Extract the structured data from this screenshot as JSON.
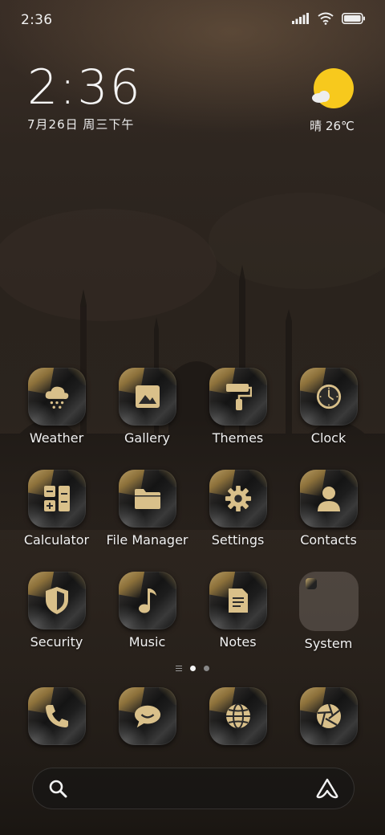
{
  "status_bar": {
    "time": "2:36",
    "icons": [
      "signal-icon",
      "wifi-icon",
      "battery-icon"
    ]
  },
  "clock_widget": {
    "time": "2:36",
    "date": "7月26日 周三下午"
  },
  "weather_widget": {
    "icon": "sun-cloud-icon",
    "text": "晴 26℃"
  },
  "apps": [
    {
      "label": "Weather",
      "icon": "weather-snow-cloud-icon"
    },
    {
      "label": "Gallery",
      "icon": "image-icon"
    },
    {
      "label": "Themes",
      "icon": "paint-roller-icon"
    },
    {
      "label": "Clock",
      "icon": "clock-icon"
    },
    {
      "label": "Calculator",
      "icon": "calculator-icon"
    },
    {
      "label": "File Manager",
      "icon": "folder-icon"
    },
    {
      "label": "Settings",
      "icon": "gear-icon"
    },
    {
      "label": "Contacts",
      "icon": "person-icon"
    },
    {
      "label": "Security",
      "icon": "shield-icon"
    },
    {
      "label": "Music",
      "icon": "music-note-icon"
    },
    {
      "label": "Notes",
      "icon": "document-icon"
    },
    {
      "label": "System",
      "icon": "folder-group-icon"
    }
  ],
  "page_indicator": {
    "pages": 2,
    "current": 1
  },
  "dock": [
    {
      "icon": "phone-icon"
    },
    {
      "icon": "message-bubble-icon"
    },
    {
      "icon": "globe-icon"
    },
    {
      "icon": "camera-aperture-icon"
    }
  ],
  "search_bar": {
    "left_icon": "search-icon",
    "right_icon": "assistant-icon"
  },
  "colors": {
    "icon_gold": "#d9c08a",
    "sun": "#f7c91d"
  }
}
